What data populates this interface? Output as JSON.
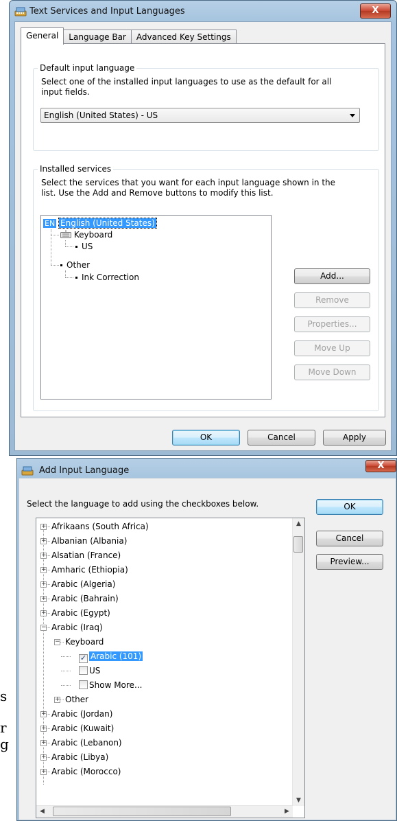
{
  "dialog1": {
    "title": "Text Services and Input Languages",
    "close_label": "X",
    "tabs": [
      {
        "label": "General",
        "active": true
      },
      {
        "label": "Language Bar",
        "active": false
      },
      {
        "label": "Advanced Key Settings",
        "active": false
      }
    ],
    "default_group": {
      "legend": "Default input language",
      "description_line1": "Select one of the installed input languages to use as the default for all",
      "description_line2": "input fields.",
      "selected_value": "English (United States) - US"
    },
    "services_group": {
      "legend": "Installed services",
      "description_line1": "Select the services that you want for each input language shown in the",
      "description_line2": "list. Use the Add and Remove buttons to modify this list.",
      "tree": {
        "lang_badge": "EN",
        "language": "English (United States)",
        "keyboard_label": "Keyboard",
        "keyboard_item": "US",
        "other_label": "Other",
        "other_item": "Ink Correction"
      },
      "buttons": {
        "add": "Add...",
        "remove": "Remove",
        "properties": "Properties...",
        "move_up": "Move Up",
        "move_down": "Move Down"
      }
    },
    "footer": {
      "ok": "OK",
      "cancel": "Cancel",
      "apply": "Apply"
    }
  },
  "dialog2": {
    "title": "Add Input Language",
    "close_label": "X",
    "instruction": "Select the language to add using the checkboxes below.",
    "buttons": {
      "ok": "OK",
      "cancel": "Cancel",
      "preview": "Preview..."
    },
    "languages_before": [
      "Afrikaans (South Africa)",
      "Albanian (Albania)",
      "Alsatian (France)",
      "Amharic (Ethiopia)",
      "Arabic (Algeria)",
      "Arabic (Bahrain)",
      "Arabic (Egypt)"
    ],
    "expanded_language": "Arabic (Iraq)",
    "keyboard_label": "Keyboard",
    "keyboards": [
      {
        "label": "Arabic (101)",
        "checked": true,
        "selected": true
      },
      {
        "label": "US",
        "checked": false,
        "selected": false
      },
      {
        "label": "Show More...",
        "checked": false,
        "selected": false
      }
    ],
    "other_label": "Other",
    "languages_after": [
      "Arabic (Jordan)",
      "Arabic (Kuwait)",
      "Arabic (Lebanon)",
      "Arabic (Libya)",
      "Arabic (Morocco)"
    ]
  },
  "background_fragments": [
    "s",
    "r",
    "g"
  ]
}
